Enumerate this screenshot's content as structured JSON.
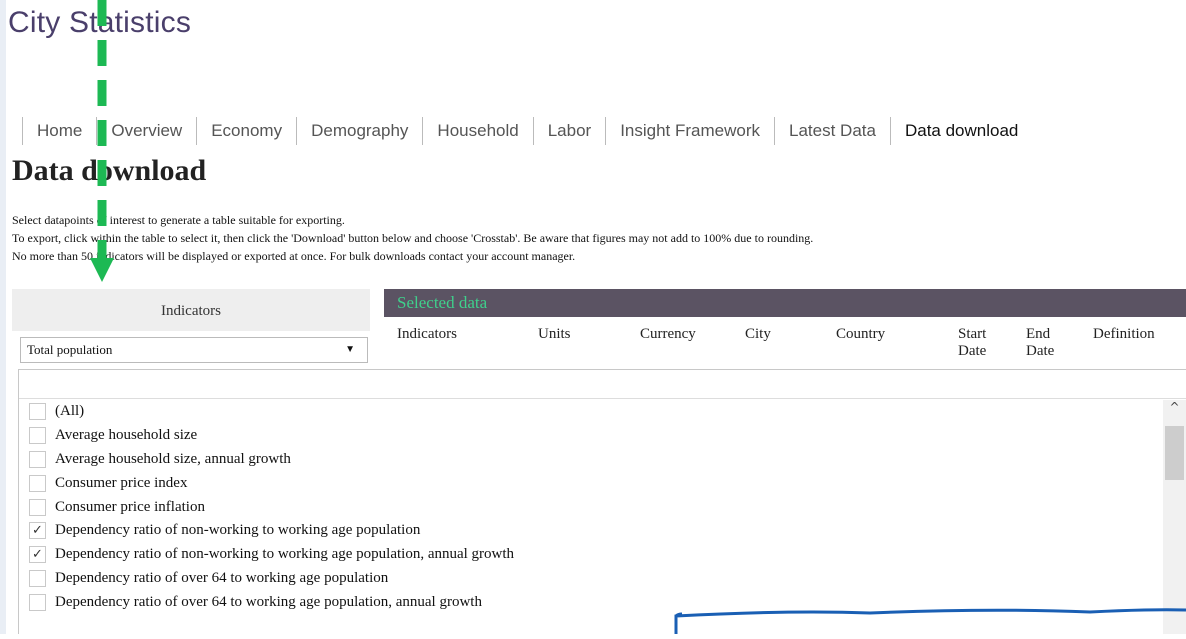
{
  "app": {
    "title": "City Statistics"
  },
  "tabs": [
    {
      "label": "Home"
    },
    {
      "label": "Overview"
    },
    {
      "label": "Economy"
    },
    {
      "label": "Demography"
    },
    {
      "label": "Household"
    },
    {
      "label": "Labor"
    },
    {
      "label": "Insight Framework"
    },
    {
      "label": "Latest Data"
    },
    {
      "label": "Data download",
      "active": true
    }
  ],
  "page": {
    "title": "Data download",
    "intro": [
      "Select datapoints of interest to generate a table suitable for exporting.",
      "To export, click within the table to select it, then click the 'Download' button below and choose 'Crosstab'. Be aware that figures may not add to 100% due to rounding.",
      "No more than 50 indicators will be displayed or exported at once. For bulk downloads contact your account manager."
    ]
  },
  "indicators": {
    "header": "Indicators",
    "dropdown_value": "Total population",
    "filter_value": "",
    "items": [
      {
        "label": "(All)",
        "checked": false
      },
      {
        "label": "Average household size",
        "checked": false
      },
      {
        "label": "Average household size, annual growth",
        "checked": false
      },
      {
        "label": "Consumer price index",
        "checked": false
      },
      {
        "label": "Consumer price inflation",
        "checked": false
      },
      {
        "label": "Dependency ratio of non-working to working age population",
        "checked": true
      },
      {
        "label": "Dependency ratio of non-working to working age population, annual growth",
        "checked": true
      },
      {
        "label": "Dependency ratio of over 64 to working age population",
        "checked": false
      },
      {
        "label": "Dependency ratio of over 64 to working age population, annual growth",
        "checked": false
      }
    ]
  },
  "selected": {
    "header": "Selected data",
    "columns": [
      "Indicators",
      "Units",
      "Currency",
      "City",
      "Country",
      "Start Date",
      "End Date",
      "Definition"
    ]
  },
  "icons": {
    "dropdown": "dropdown-arrow-icon",
    "scroll_up": "chevron-up-icon",
    "check": "checkmark-icon"
  },
  "colors": {
    "title": "#4a3f6b",
    "selected_header_bg": "#5b5363",
    "selected_header_text": "#3fd08c",
    "annotation_arrow": "#1db954",
    "annotation_box": "#1a5fb4"
  }
}
